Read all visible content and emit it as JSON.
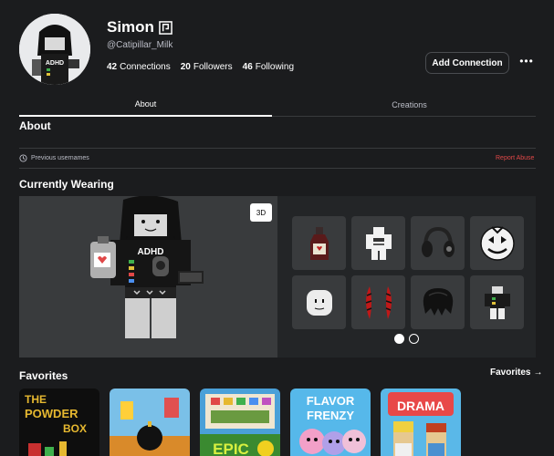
{
  "profile": {
    "display_name": "Simon",
    "username": "@Catipillar_Milk",
    "connections_count": "42",
    "connections_label": "Connections",
    "followers_count": "20",
    "followers_label": "Followers",
    "following_count": "46",
    "following_label": "Following",
    "add_connection_label": "Add Connection",
    "more_label": "•••",
    "avatar_shirt_text": "ADHD"
  },
  "tabs": [
    {
      "label": "About",
      "active": true
    },
    {
      "label": "Creations",
      "active": false
    }
  ],
  "about": {
    "heading": "About",
    "previous_usernames_label": "Previous usernames",
    "report_label": "Report Abuse"
  },
  "currently_wearing": {
    "heading": "Currently Wearing",
    "view_3d_label": "3D",
    "shirt_text": "ADHD",
    "items": [
      {
        "icon": "bottle-icon"
      },
      {
        "icon": "shirt-icon"
      },
      {
        "icon": "headphones-icon"
      },
      {
        "icon": "clown-face-icon"
      },
      {
        "icon": "plain-face-icon"
      },
      {
        "icon": "red-horns-icon"
      },
      {
        "icon": "black-hair-icon"
      },
      {
        "icon": "avatar-outfit-icon"
      }
    ],
    "page_count": 2,
    "current_page": 1
  },
  "favorites": {
    "heading": "Favorites",
    "link_label": "Favorites",
    "link_arrow": "→",
    "games": [
      {
        "title_line1": "THE",
        "title_line2": "POWDER",
        "title_line3": "BOX"
      },
      {
        "title_line1": ""
      },
      {
        "title_line1": "EPIC"
      },
      {
        "title_line1": "FLAVOR",
        "title_line2": "FRENZY"
      },
      {
        "title_line1": "DRAMA"
      }
    ]
  },
  "colors": {
    "background": "#1b1c1e",
    "panel": "#232527",
    "panel_light": "#393b3d",
    "report": "#e04848"
  }
}
